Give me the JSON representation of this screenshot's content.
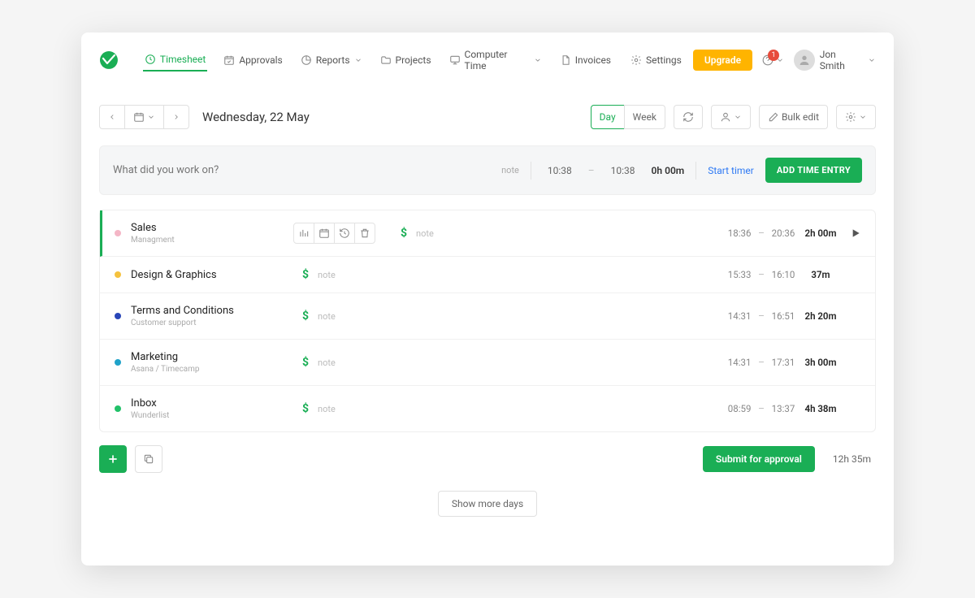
{
  "colors": {
    "primary": "#1aae55",
    "accent": "#ffb400",
    "danger": "#e74c3c"
  },
  "nav": {
    "items": [
      {
        "label": "Timesheet",
        "icon": "clock",
        "active": true,
        "chev": false
      },
      {
        "label": "Approvals",
        "icon": "calendar-check",
        "active": false,
        "chev": false
      },
      {
        "label": "Reports",
        "icon": "pie",
        "active": false,
        "chev": true
      },
      {
        "label": "Projects",
        "icon": "folder",
        "active": false,
        "chev": false
      },
      {
        "label": "Computer Time",
        "icon": "monitor",
        "active": false,
        "chev": true
      },
      {
        "label": "Invoices",
        "icon": "file",
        "active": false,
        "chev": false
      }
    ],
    "settings": "Settings",
    "upgrade": "Upgrade",
    "notifications": "1",
    "user_name": "Jon Smith"
  },
  "toolbar": {
    "date": "Wednesday, 22 May",
    "day": "Day",
    "week": "Week",
    "bulk_edit": "Bulk edit"
  },
  "entry_bar": {
    "placeholder": "What did you work on?",
    "note": "note",
    "from": "10:38",
    "to": "10:38",
    "duration": "0h 00m",
    "start_timer": "Start timer",
    "add": "ADD TIME ENTRY"
  },
  "entries": [
    {
      "color": "#f4b6c6",
      "name": "Sales",
      "sub": "Managment",
      "note": "note",
      "from": "18:36",
      "to": "20:36",
      "dur": "2h 00m",
      "actions": true,
      "play": true
    },
    {
      "color": "#f5c23e",
      "name": "Design & Graphics",
      "sub": "",
      "note": "note",
      "from": "15:33",
      "to": "16:10",
      "dur": "37m",
      "actions": false,
      "play": false
    },
    {
      "color": "#2946b8",
      "name": "Terms and Conditions",
      "sub": "Customer support",
      "note": "note",
      "from": "14:31",
      "to": "16:51",
      "dur": "2h 20m",
      "actions": false,
      "play": false
    },
    {
      "color": "#1fa2c9",
      "name": "Marketing",
      "sub": "Asana / Timecamp",
      "note": "note",
      "from": "14:31",
      "to": "17:31",
      "dur": "3h 00m",
      "actions": false,
      "play": false
    },
    {
      "color": "#22c169",
      "name": "Inbox",
      "sub": "Wunderlist",
      "note": "note",
      "from": "08:59",
      "to": "13:37",
      "dur": "4h 38m",
      "actions": false,
      "play": false
    }
  ],
  "footer": {
    "submit": "Submit for approval",
    "total": "12h 35m",
    "showmore": "Show more days"
  }
}
